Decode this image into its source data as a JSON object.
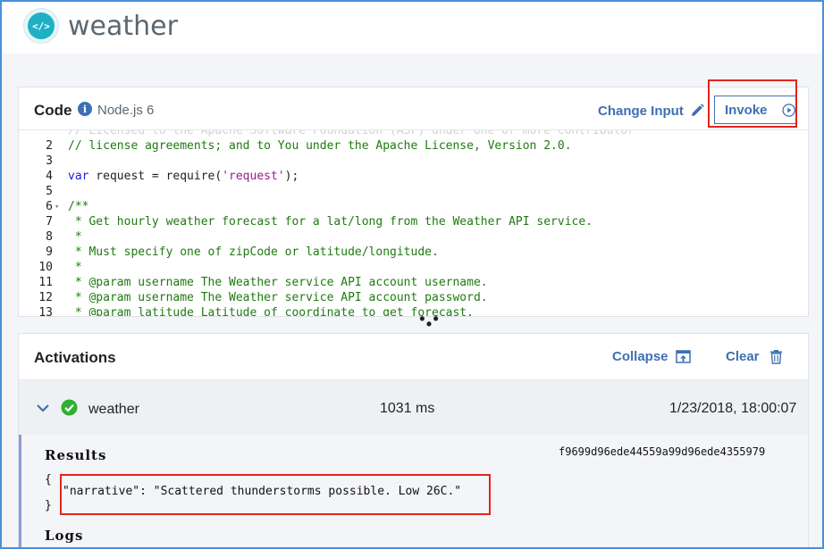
{
  "app": {
    "title": "weather",
    "logo_glyph": "</>"
  },
  "code_panel": {
    "title": "Code",
    "info_icon_glyph": "i",
    "runtime": "Node.js 6",
    "change_input_label": "Change Input",
    "invoke_label": "Invoke",
    "lines": [
      {
        "n": "",
        "text": "// Licensed to the Apache Software Foundation (ASF) under one or more contributor",
        "fold": "",
        "kind": "ghost"
      },
      {
        "n": "2",
        "text": "// license agreements; and to You under the Apache License, Version 2.0.",
        "fold": "",
        "kind": "cm"
      },
      {
        "n": "3",
        "text": "",
        "fold": "",
        "kind": "plain"
      },
      {
        "n": "4",
        "text": "",
        "fold": "",
        "kind": "require"
      },
      {
        "n": "5",
        "text": "",
        "fold": "",
        "kind": "plain"
      },
      {
        "n": "6",
        "text": "/**",
        "fold": "▾",
        "kind": "cm"
      },
      {
        "n": "7",
        "text": " * Get hourly weather forecast for a lat/long from the Weather API service.",
        "fold": "",
        "kind": "cm"
      },
      {
        "n": "8",
        "text": " *",
        "fold": "",
        "kind": "cm"
      },
      {
        "n": "9",
        "text": " * Must specify one of zipCode or latitude/longitude.",
        "fold": "",
        "kind": "cm"
      },
      {
        "n": "10",
        "text": " *",
        "fold": "",
        "kind": "cm"
      },
      {
        "n": "11",
        "text": " * @param username The Weather service API account username.",
        "fold": "",
        "kind": "cm"
      },
      {
        "n": "12",
        "text": " * @param username The Weather service API account password.",
        "fold": "",
        "kind": "cm"
      },
      {
        "n": "13",
        "text": " * @param latitude Latitude of coordinate to get forecast.",
        "fold": "",
        "kind": "cm"
      }
    ],
    "require_line": {
      "kw": "var",
      "mid": " request = require(",
      "str": "'request'",
      "end": ");"
    }
  },
  "splitter_glyph": "• • •",
  "activations": {
    "title": "Activations",
    "collapse_label": "Collapse",
    "clear_label": "Clear",
    "rows": [
      {
        "name": "weather",
        "duration": "1031 ms",
        "timestamp": "1/23/2018, 18:00:07",
        "status": "success",
        "results_label": "Results",
        "activation_id": "f9699d96ede44559a99d96ede4355979",
        "json_open": "{",
        "json_body": "\"narrative\": \"Scattered thunderstorms possible. Low 26C.\"",
        "json_close": "}",
        "logs_label": "Logs"
      }
    ]
  },
  "colors": {
    "accent": "#3d70b2",
    "highlight": "#e3231b",
    "success": "#30b030",
    "logo": "#1fb0c4"
  }
}
